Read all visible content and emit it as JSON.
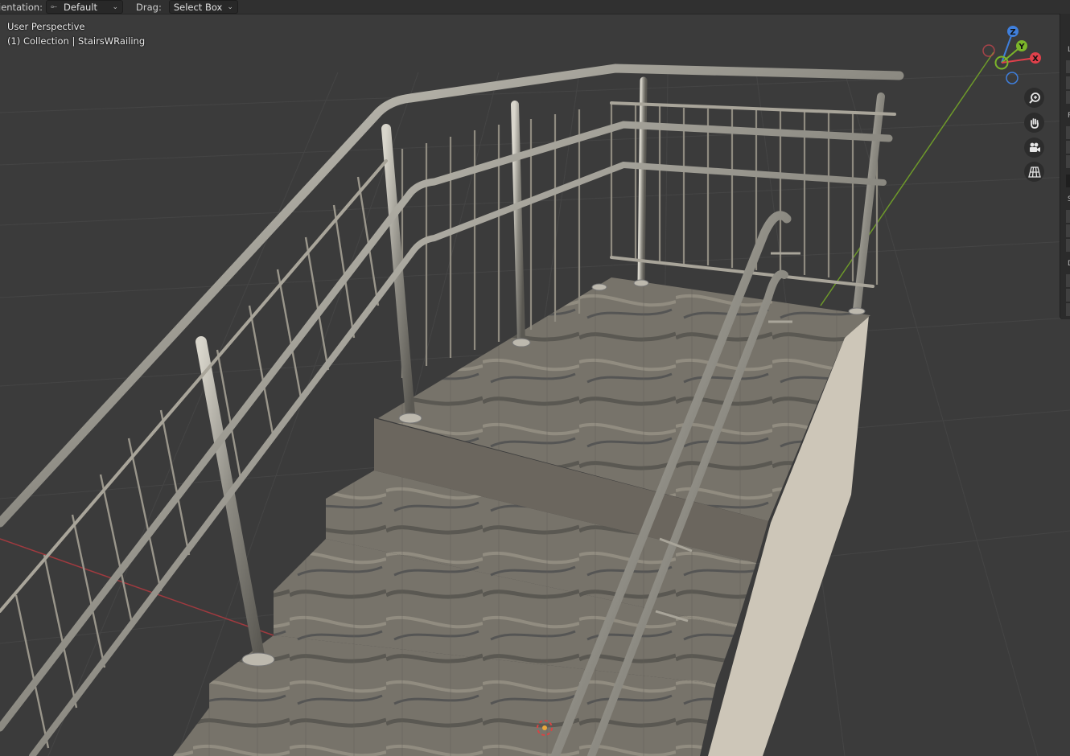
{
  "header": {
    "orientation_label": "ientation:",
    "orientation_value": "Default",
    "drag_label": "Drag:",
    "drag_value": "Select Box"
  },
  "viewport": {
    "view_name": "User Perspective",
    "collection_info": "(1) Collection | StairsWRailing"
  },
  "gizmo": {
    "axes": [
      "Z",
      "Y",
      "X"
    ],
    "colors": {
      "x": "#e0404b",
      "y": "#7bb52a",
      "z": "#3f7fdc"
    }
  },
  "nav_buttons": [
    "zoom-icon",
    "hand-pan-icon",
    "camera-icon",
    "grid-ortho-icon"
  ],
  "sidebar": {
    "letters": [
      "L",
      "P",
      "S",
      "D"
    ]
  },
  "colors": {
    "viewport_bg": "#3b3b3b",
    "header_bg": "#303030",
    "grid_line": "#454545",
    "x_axis": "#a03a3f",
    "y_axis": "#6e9a2a"
  }
}
